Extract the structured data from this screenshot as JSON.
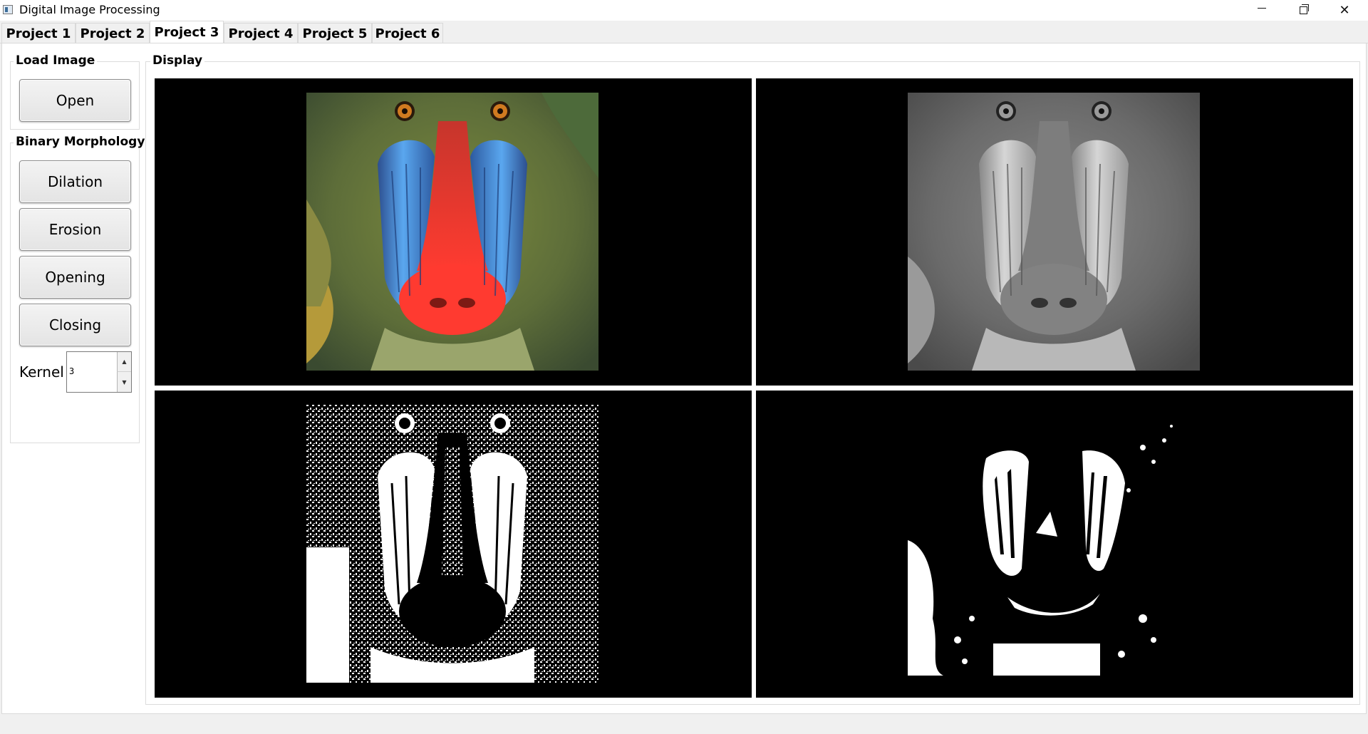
{
  "window": {
    "title": "Digital Image Processing",
    "controls": [
      "minimize-icon",
      "restore-icon",
      "close-icon"
    ]
  },
  "tabs": [
    {
      "label": "Project 1",
      "active": false
    },
    {
      "label": "Project 2",
      "active": false
    },
    {
      "label": "Project 3",
      "active": true
    },
    {
      "label": "Project 4",
      "active": false
    },
    {
      "label": "Project 5",
      "active": false
    },
    {
      "label": "Project 6",
      "active": false
    }
  ],
  "load_image": {
    "title": "Load Image",
    "open_label": "Open"
  },
  "morphology": {
    "title": "Binary Morphology",
    "dilation_label": "Dilation",
    "erosion_label": "Erosion",
    "opening_label": "Opening",
    "closing_label": "Closing",
    "kernel_label": "Kernel",
    "kernel_value": "3"
  },
  "display": {
    "title": "Display",
    "panels": [
      {
        "content": "color mandrill image"
      },
      {
        "content": "grayscale mandrill image"
      },
      {
        "content": "binary threshold mandrill image"
      },
      {
        "content": "morphology result mandrill image"
      }
    ]
  },
  "colors": {
    "accent_blue": "#4f8fe6",
    "nose_red": "#f03a2a",
    "fur_olive": "#6d7a3a"
  }
}
